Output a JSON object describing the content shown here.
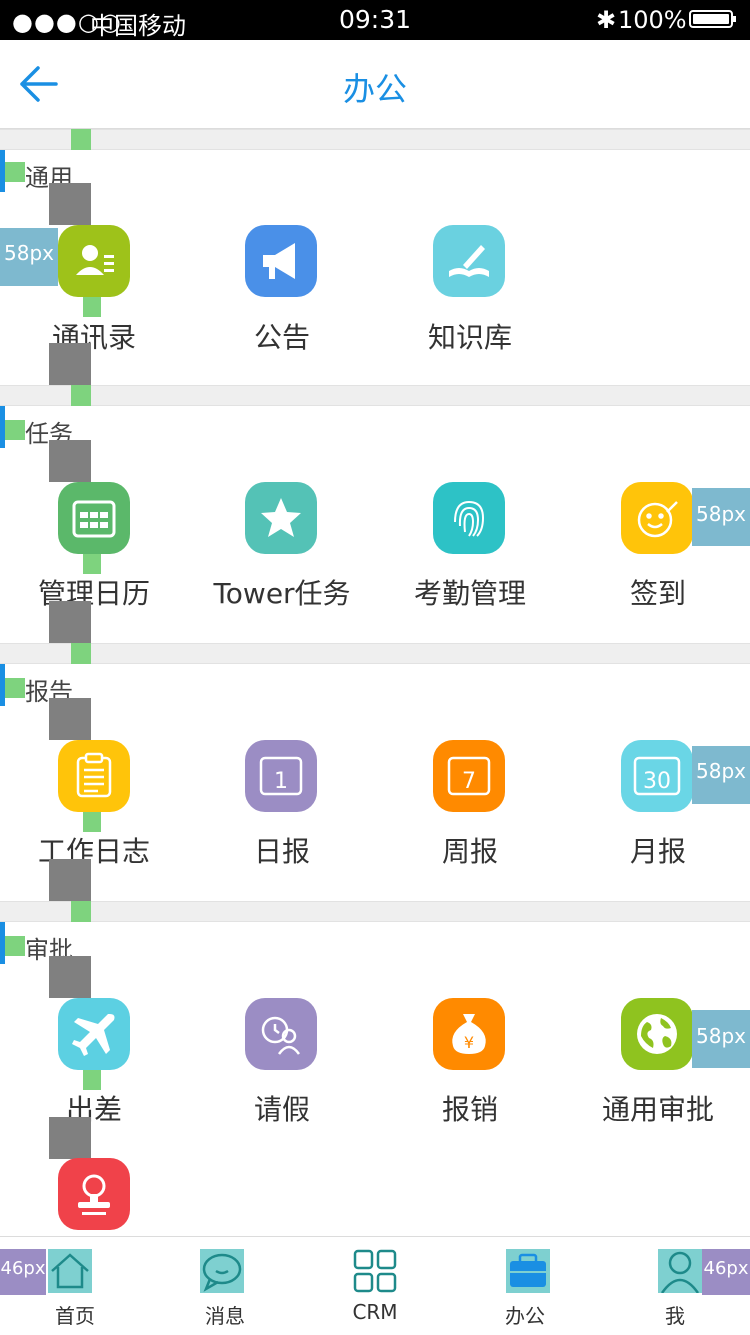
{
  "status_bar": {
    "signal": "●●●○○",
    "carrier": "中国移动",
    "time": "09:31",
    "bluetooth": "✱",
    "battery_pct": "100%"
  },
  "nav": {
    "title": "办公",
    "back_icon": "arrow-left-icon"
  },
  "sections": [
    {
      "title": "通用",
      "items": [
        {
          "label": "通讯录",
          "icon": "contacts-icon",
          "color": "#9ec21a"
        },
        {
          "label": "公告",
          "icon": "megaphone-icon",
          "color": "#4a90e8"
        },
        {
          "label": "知识库",
          "icon": "book-icon",
          "color": "#6ad1e0"
        }
      ]
    },
    {
      "title": "任务",
      "items": [
        {
          "label": "管理日历",
          "icon": "calendar-icon",
          "color": "#5bb86a"
        },
        {
          "label": "Tower任务",
          "icon": "star-icon",
          "color": "#54c2b6"
        },
        {
          "label": "考勤管理",
          "icon": "fingerprint-icon",
          "color": "#2dc2c6"
        },
        {
          "label": "签到",
          "icon": "smile-sign-icon",
          "color": "#ffc40a"
        }
      ]
    },
    {
      "title": "报告",
      "items": [
        {
          "label": "工作日志",
          "icon": "clipboard-icon",
          "color": "#ffc40a"
        },
        {
          "label": "日报",
          "icon": "daily-1-icon",
          "color": "#9b8dc4"
        },
        {
          "label": "周报",
          "icon": "weekly-7-icon",
          "color": "#ff8a00"
        },
        {
          "label": "月报",
          "icon": "monthly-30-icon",
          "color": "#6ad6e6"
        }
      ]
    },
    {
      "title": "审批",
      "items": [
        {
          "label": "出差",
          "icon": "airplane-icon",
          "color": "#5cd0e2"
        },
        {
          "label": "请假",
          "icon": "leave-icon",
          "color": "#9b8dc4"
        },
        {
          "label": "报销",
          "icon": "money-bag-icon",
          "color": "#ff8a00"
        },
        {
          "label": "通用审批",
          "icon": "globe-icon",
          "color": "#8fc31f"
        },
        {
          "label": "",
          "icon": "stamp-icon",
          "color": "#f0424a"
        }
      ]
    }
  ],
  "annotations": {
    "px58": "58px",
    "px46": "46px"
  },
  "tabs": [
    {
      "label": "首页",
      "icon": "home-icon"
    },
    {
      "label": "消息",
      "icon": "chat-icon"
    },
    {
      "label": "CRM",
      "icon": "grid-icon"
    },
    {
      "label": "办公",
      "icon": "briefcase-icon"
    },
    {
      "label": "我",
      "icon": "person-icon"
    }
  ]
}
